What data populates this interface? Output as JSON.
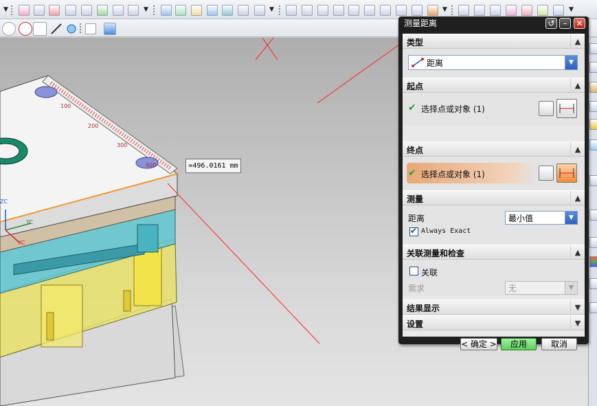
{
  "dialog": {
    "title": "测量距离",
    "type_section": "类型",
    "type_value": "距离",
    "start_section": "起点",
    "start_prompt": "选择点或对象 (1)",
    "end_section": "终点",
    "end_prompt": "选择点或对象 (1)",
    "measure_section": "测量",
    "distance_label": "距离",
    "distance_value": "最小值",
    "always_exact": "Always Exact",
    "assoc_section": "关联测量和检查",
    "assoc_label": "关联",
    "require_label": "需求",
    "require_value": "无",
    "result_section": "结果显示",
    "settings_section": "设置",
    "ok_button": "< 确定 >",
    "apply_button": "应用",
    "cancel_button": "取消"
  },
  "viewport": {
    "dimension_label": "=496.0161 mm",
    "ruler_ticks": [
      "100",
      "200",
      "300",
      "400"
    ],
    "axis_zc": "ZC",
    "axis_yc": "YC",
    "axis_xc": "XC"
  },
  "colors": {
    "dialog_highlight": "#e8a878",
    "apply_green": "#5ad05a",
    "mold_cyan": "#5fc6d0",
    "mold_yellow": "#e8e06a",
    "measure_line": "#ff2222"
  }
}
